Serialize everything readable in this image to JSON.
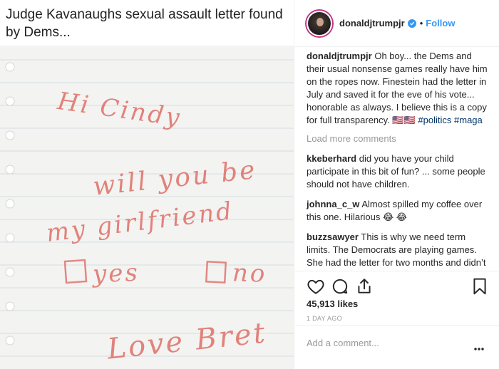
{
  "media": {
    "caption": "Judge Kavanaughs sexual assault letter found by Dems...",
    "note_lines": [
      "Hi Cindy",
      "will you be",
      "my girlfriend",
      "yes",
      "no",
      "Love Bret"
    ]
  },
  "header": {
    "username": "donaldjtrumpjr",
    "separator": "•",
    "follow_label": "Follow"
  },
  "post": {
    "username": "donaldjtrumpjr",
    "text": "Oh boy... the Dems and their usual nonsense games really have him on the ropes now. Finestein had the letter in July and saved it for the eve of his vote... honorable as always. I believe this is a copy for full transparency. ",
    "emoji": "🇺🇸🇺🇸",
    "hashtags": [
      "#politics",
      "#maga"
    ]
  },
  "load_more_label": "Load more comments",
  "comments": [
    {
      "user": "kkeberhard",
      "text": "did you have your child participate in this bit of fun? ... some people should not have children."
    },
    {
      "user": "johnna_c_w",
      "text": "Almost spilled my coffee over this one. Hilarious 😂 😂"
    },
    {
      "user": "buzzsawyer",
      "text": "This is why we need term limits. The Democrats are playing games. She had the letter for two months and didn’t say anything until after the hearing. That not right."
    }
  ],
  "icons": [
    "heart-icon",
    "comment-icon",
    "share-icon",
    "bookmark-icon",
    "more-icon",
    "verified-badge-icon"
  ],
  "likes_label": "45,913 likes",
  "time_label": "1 DAY AGO",
  "add_comment_placeholder": "Add a comment...",
  "colors": {
    "link": "#3897f0",
    "hashtag": "#003569",
    "muted": "#999999",
    "ink": "#e0766f"
  }
}
